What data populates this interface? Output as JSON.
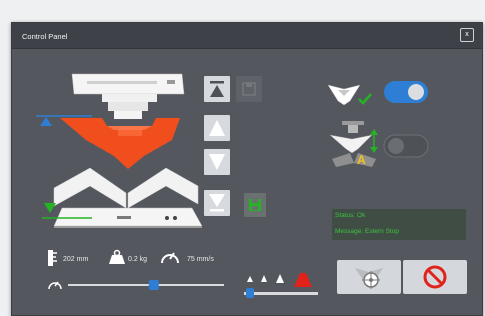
{
  "window": {
    "title": "Control Panel",
    "close_label": "x"
  },
  "metrics": {
    "height_value": "202 mm",
    "weight_value": "0.2 kg",
    "speed_value": "75 mm/s"
  },
  "status": {
    "status_text": "Status: Ok",
    "message_text": "Message: Estern Stop"
  },
  "toggles": {
    "main_toggle_on": true,
    "auto_toggle_on": false,
    "auto_badge": "A"
  },
  "slider": {
    "position_fraction": 0.55
  },
  "weight_selector": {
    "selected_index": 3,
    "count": 4
  },
  "colors": {
    "accent_blue": "#2e7ed6",
    "accent_orange": "#f04e1c",
    "accent_green": "#25b325",
    "stop_red": "#e0221b"
  }
}
